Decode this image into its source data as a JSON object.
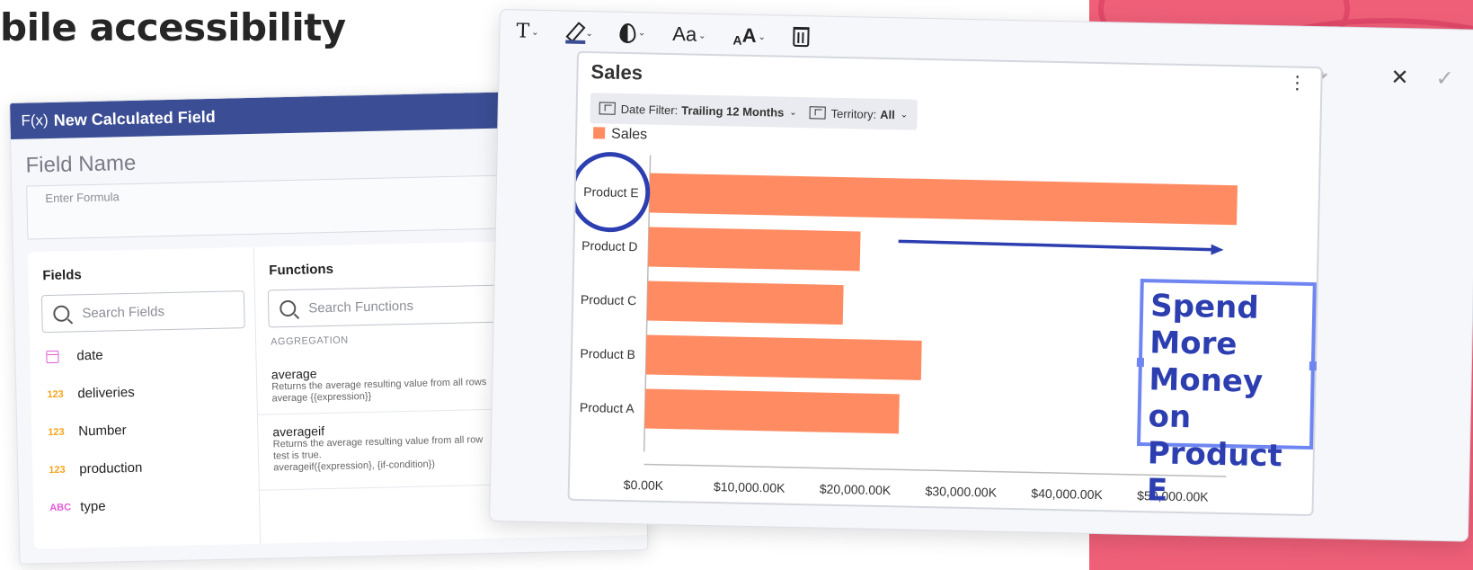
{
  "headline": "bile accessibility",
  "calc_window": {
    "title": "New Calculated Field",
    "fx_label": "F(x)",
    "field_name_label": "Field Name",
    "formula_placeholder": "Enter Formula",
    "fields_title": "Fields",
    "fields_search_placeholder": "Search Fields",
    "fields": [
      {
        "icon": "calendar-icon",
        "type_label": "",
        "name": "date"
      },
      {
        "icon": "number-icon",
        "type_label": "123",
        "name": "deliveries"
      },
      {
        "icon": "number-icon",
        "type_label": "123",
        "name": "Number"
      },
      {
        "icon": "number-icon",
        "type_label": "123",
        "name": "production"
      },
      {
        "icon": "text-icon",
        "type_label": "ABC",
        "name": "type"
      }
    ],
    "functions_title": "Functions",
    "functions_search_placeholder": "Search Functions",
    "aggregation_label": "AGGREGATION",
    "functions": [
      {
        "name": "average",
        "desc": [
          "Returns the average resulting value from all rows",
          "average {{expression}}"
        ]
      },
      {
        "name": "averageif",
        "desc": [
          "Returns the average resulting value from all row",
          "test is true.",
          "averageif({expression}, {if-condition})"
        ]
      }
    ]
  },
  "editor": {
    "toolbar": [
      "text-tool",
      "highlight-tool",
      "color-tool",
      "font-tool",
      "font-size-tool",
      "delete-tool"
    ],
    "toolbar_glyphs": {
      "text": "T",
      "font": "Aa",
      "size_small": "A",
      "size_large": "A"
    },
    "actions": {
      "undo": "↶",
      "redo": "↷",
      "close": "✕",
      "confirm": "✓"
    },
    "card": {
      "title": "Sales",
      "menu_glyph": "⋮",
      "date_filter": {
        "label": "Date Filter:",
        "value": "Trailing 12 Months"
      },
      "territory_filter": {
        "label": "Territory:",
        "value": "All"
      }
    },
    "annotation": {
      "lines": [
        "Spend",
        "More",
        "Money on",
        "Product E"
      ]
    }
  },
  "chart_data": {
    "type": "bar",
    "orientation": "horizontal",
    "title": "Sales",
    "categories": [
      "Product E",
      "Product D",
      "Product C",
      "Product B",
      "Product A"
    ],
    "series": [
      {
        "name": "Sales",
        "values": [
          55500,
          20000,
          18500,
          26000,
          24000
        ],
        "color": "#ff8b62"
      }
    ],
    "xlim": [
      0,
      55000
    ],
    "x_ticks": [
      "$0.00K",
      "$10,000.00K",
      "$20,000.00K",
      "$30,000.00K",
      "$40,000.00K",
      "$50,000.00K"
    ],
    "legend_position": "top-left",
    "highlight_category": "Product E",
    "colors": {
      "annotation": "#2d3fb0",
      "bar": "#ff8b62"
    }
  }
}
